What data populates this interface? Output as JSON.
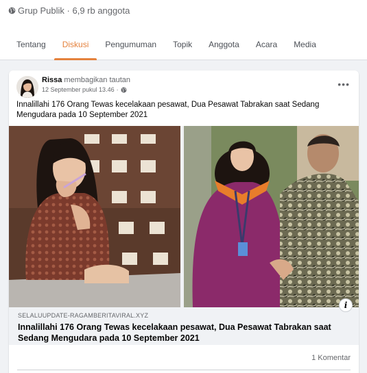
{
  "group": {
    "privacy_icon": "globe-icon",
    "meta": "Grup Publik · 6,9 rb anggota"
  },
  "tabs": [
    {
      "label": "Tentang"
    },
    {
      "label": "Diskusi",
      "active": true
    },
    {
      "label": "Pengumuman"
    },
    {
      "label": "Topik"
    },
    {
      "label": "Anggota"
    },
    {
      "label": "Acara"
    },
    {
      "label": "Media"
    }
  ],
  "colors": {
    "accent": "#e4813c",
    "background": "#f0f2f5",
    "secondary_text": "#65676b"
  },
  "post": {
    "author": "Rissa",
    "action": " membagikan tautan",
    "timestamp": "12 September pukul 13.46",
    "audience_icon": "globe-icon",
    "more_icon": "more-horizontal-icon",
    "more_label": "•••",
    "text": "Innalillahi 176 Orang Tewas kecelakaan pesawat, Dua Pesawat Tabrakan saat Sedang Mengudara pada 10 September 2021",
    "link": {
      "domain": "SELALUUPDATE-RAGAMBERITAVIRAL.XYZ",
      "title": "Innalillahi 176 Orang Tewas kecelakaan pesawat, Dua Pesawat Tabrakan saat Sedang Mengudara pada 10 September 2021",
      "info_label": "i"
    },
    "comments": "1 Komentar"
  }
}
